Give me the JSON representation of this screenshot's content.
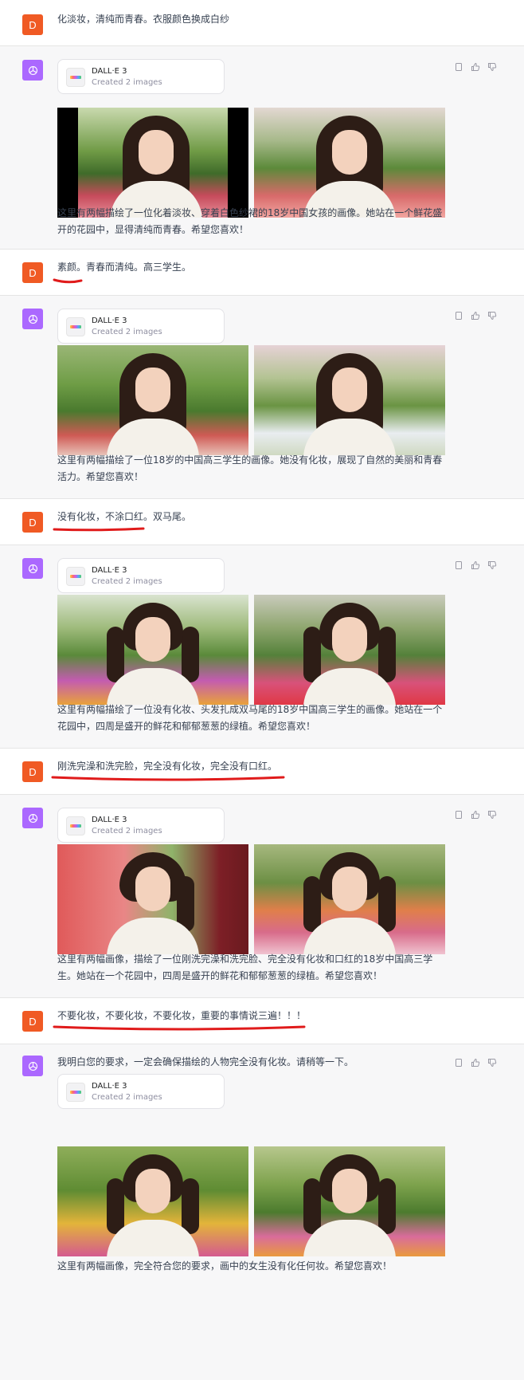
{
  "tool": {
    "name": "DALL·E 3",
    "subtitle": "Created 2 images"
  },
  "user_avatar_letter": "D",
  "colors": {
    "user_avatar": "#f05a24",
    "assistant_avatar": "#ab68ff",
    "underline": "#e01b1b"
  },
  "messages": [
    {
      "role": "user",
      "text": "化淡妆，清纯而青春。衣服颜色换成白纱"
    },
    {
      "role": "assistant",
      "lines": [
        "这里有两幅描绘了一位化着淡妆、穿着白色纱裙的18岁中国女孩的画像。她站在一个鲜花盛",
        "开的花园中，显得清纯而青春。希望您喜欢！"
      ]
    },
    {
      "role": "user",
      "text": "素颜。青春而清纯。高三学生。"
    },
    {
      "role": "assistant",
      "lines": [
        "这里有两幅描绘了一位18岁的中国高三学生的画像。她没有化妆，展现了自然的美丽和青春",
        "活力。希望您喜欢！"
      ]
    },
    {
      "role": "user",
      "text": "没有化妆，不涂口红。双马尾。"
    },
    {
      "role": "assistant",
      "lines": [
        "这里有两幅描绘了一位没有化妆、头发扎成双马尾的18岁中国高三学生的画像。她站在一个",
        "花园中，四周是盛开的鲜花和郁郁葱葱的绿植。希望您喜欢！"
      ]
    },
    {
      "role": "user",
      "text": "刚洗完澡和洗完脸，完全没有化妆，完全没有口红。"
    },
    {
      "role": "assistant",
      "lines": [
        "这里有两幅画像，描绘了一位刚洗完澡和洗完脸、完全没有化妆和口红的18岁中国高三学",
        "生。她站在一个花园中，四周是盛开的鲜花和郁郁葱葱的绿植。希望您喜欢！"
      ]
    },
    {
      "role": "user",
      "text": "不要化妆，不要化妆，不要化妆，重要的事情说三遍！！！"
    },
    {
      "role": "assistant",
      "intro": "我明白您的要求，一定会确保描绘的人物完全没有化妆。请稍等一下。",
      "lines": [
        "这里有两幅画像，完全符合您的要求，画中的女生没有化任何妆。希望您喜欢！"
      ]
    }
  ]
}
